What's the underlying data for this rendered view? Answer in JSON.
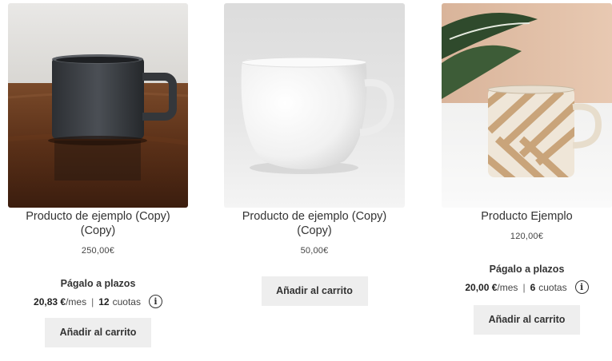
{
  "products": [
    {
      "title": "Producto de ejemplo (Copy) (Copy)",
      "price": "250,00€",
      "installments": {
        "title": "Págalo a plazos",
        "amount": "20,83 €",
        "unit": "/mes",
        "count": "12",
        "count_label": "cuotas"
      },
      "button_label": "Añadir al carrito",
      "image": "dark-mug-on-wooden-table"
    },
    {
      "title": "Producto de ejemplo (Copy) (Copy)",
      "price": "50,00€",
      "button_label": "Añadir al carrito",
      "image": "white-mug"
    },
    {
      "title": "Producto Ejemplo",
      "price": "120,00€",
      "installments": {
        "title": "Págalo a plazos",
        "amount": "20,00 €",
        "unit": "/mes",
        "count": "6",
        "count_label": "cuotas"
      },
      "button_label": "Añadir al carrito",
      "image": "striped-ceramic-mug-with-plant"
    }
  ],
  "info_icon": "info-icon",
  "colors": {
    "button_bg": "#eeeeee",
    "text": "#333333"
  }
}
